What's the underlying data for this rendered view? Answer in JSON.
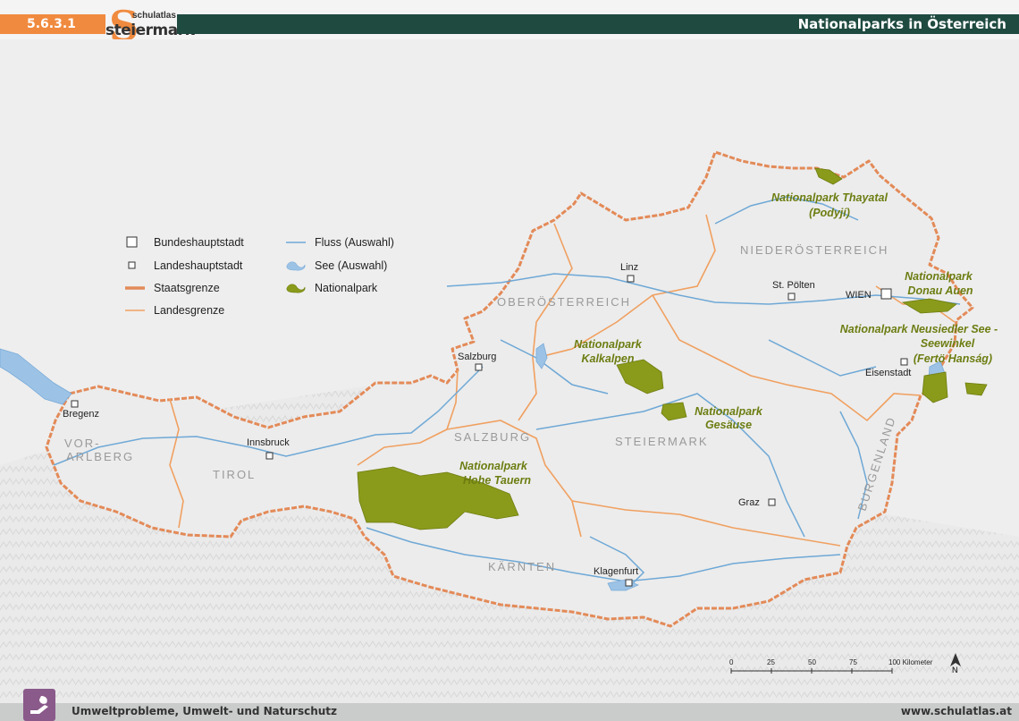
{
  "header": {
    "chapter": "5.6.3.1",
    "logo_small": "schulatlas",
    "logo_big": "steiermark",
    "logo_letter": "S",
    "title": "Nationalparks in Österreich"
  },
  "footer": {
    "topic": "Umweltprobleme, Umwelt- und Naturschutz",
    "url": "www.schulatlas.at"
  },
  "legend": {
    "items": [
      {
        "label": "Bundeshauptstadt"
      },
      {
        "label": "Landeshauptstadt"
      },
      {
        "label": "Staatsgrenze"
      },
      {
        "label": "Landesgrenze"
      },
      {
        "label": "Fluss (Auswahl)"
      },
      {
        "label": "See (Auswahl)"
      },
      {
        "label": "Nationalpark"
      }
    ]
  },
  "states": [
    {
      "label": "NIEDERÖSTERREICH"
    },
    {
      "label": "OBERÖSTERREICH"
    },
    {
      "label": "SALZBURG"
    },
    {
      "label": "STEIERMARK"
    },
    {
      "label": "TIROL"
    },
    {
      "label": "VOR-"
    },
    {
      "label": "ARLBERG"
    },
    {
      "label": "KÄRNTEN"
    },
    {
      "label": "BURGENLAND"
    }
  ],
  "cities": [
    {
      "label": "WIEN"
    },
    {
      "label": "St. Pölten"
    },
    {
      "label": "Linz"
    },
    {
      "label": "Salzburg"
    },
    {
      "label": "Eisenstadt"
    },
    {
      "label": "Bregenz"
    },
    {
      "label": "Innsbruck"
    },
    {
      "label": "Graz"
    },
    {
      "label": "Klagenfurt"
    }
  ],
  "parks": [
    {
      "lines": [
        "Nationalpark Thayatal",
        "(Podyjí)"
      ]
    },
    {
      "lines": [
        "Nationalpark",
        "Donau Auen"
      ]
    },
    {
      "lines": [
        "Nationalpark Neusiedler See -",
        "Seewinkel",
        "(Fertö Hanság)"
      ]
    },
    {
      "lines": [
        "Nationalpark",
        "Kalkalpen"
      ]
    },
    {
      "lines": [
        "Nationalpark",
        "Gesäuse"
      ]
    },
    {
      "lines": [
        "Nationalpark",
        "Hohe Tauern"
      ]
    }
  ],
  "scale": {
    "ticks": [
      "0",
      "25",
      "50",
      "75",
      "100 Kilometer"
    ]
  },
  "north_label": "N",
  "colors": {
    "accent_orange": "#f08a3e",
    "title_bar": "#1f4a40",
    "park_green": "#8a9a1a",
    "river_blue": "#6ea8d6",
    "lake_blue": "#9cc3e6",
    "state_border": "#f0a060",
    "national_border": "#e99a66"
  }
}
